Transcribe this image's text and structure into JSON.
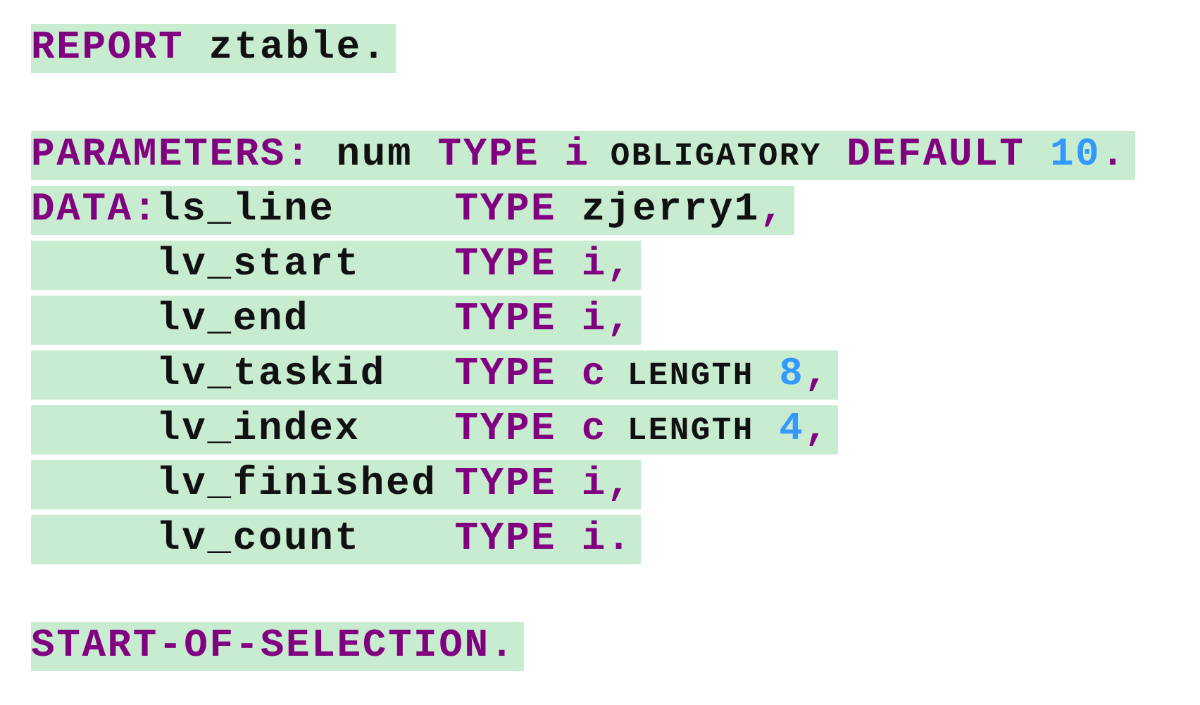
{
  "code_lines": [
    {
      "kind": "code",
      "tokens": [
        {
          "kind": "keyword",
          "text": "REPORT"
        },
        {
          "kind": "ident",
          "text": "ztable."
        }
      ]
    },
    {
      "kind": "blank"
    },
    {
      "kind": "code",
      "tokens": [
        {
          "kind": "keyword",
          "text": "PARAMETERS:"
        },
        {
          "kind": "ident",
          "text": "num"
        },
        {
          "kind": "keyword",
          "text": "TYPE"
        },
        {
          "kind": "keyword",
          "text": "i"
        },
        {
          "kind": "small",
          "text": "OBLIGATORY"
        },
        {
          "kind": "keyword",
          "text": "DEFAULT"
        },
        {
          "kind": "number",
          "text": "10"
        },
        {
          "kind": "punct",
          "text": "."
        }
      ]
    },
    {
      "kind": "decl",
      "lead": "DATA:",
      "name": "ls_line",
      "tokens": [
        {
          "kind": "keyword",
          "text": "TYPE"
        },
        {
          "kind": "ident",
          "text": "zjerry1"
        },
        {
          "kind": "punct",
          "text": ","
        }
      ]
    },
    {
      "kind": "decl",
      "name": "lv_start",
      "tokens": [
        {
          "kind": "keyword",
          "text": "TYPE"
        },
        {
          "kind": "keyword",
          "text": "i,"
        }
      ]
    },
    {
      "kind": "decl",
      "name": "lv_end",
      "tokens": [
        {
          "kind": "keyword",
          "text": "TYPE"
        },
        {
          "kind": "keyword",
          "text": "i,"
        }
      ]
    },
    {
      "kind": "decl",
      "name": "lv_taskid",
      "tokens": [
        {
          "kind": "keyword",
          "text": "TYPE"
        },
        {
          "kind": "keyword",
          "text": "c"
        },
        {
          "kind": "small",
          "text": "LENGTH"
        },
        {
          "kind": "number",
          "text": "8"
        },
        {
          "kind": "punct",
          "text": ","
        }
      ]
    },
    {
      "kind": "decl",
      "name": "lv_index",
      "tokens": [
        {
          "kind": "keyword",
          "text": "TYPE"
        },
        {
          "kind": "keyword",
          "text": "c"
        },
        {
          "kind": "small",
          "text": "LENGTH"
        },
        {
          "kind": "number",
          "text": "4"
        },
        {
          "kind": "punct",
          "text": ","
        }
      ]
    },
    {
      "kind": "decl",
      "name": "lv_finished",
      "tokens": [
        {
          "kind": "keyword",
          "text": "TYPE"
        },
        {
          "kind": "keyword",
          "text": "i,"
        }
      ]
    },
    {
      "kind": "decl",
      "name": "lv_count",
      "tokens": [
        {
          "kind": "keyword",
          "text": "TYPE"
        },
        {
          "kind": "keyword",
          "text": "i."
        }
      ]
    },
    {
      "kind": "blank"
    },
    {
      "kind": "code",
      "tokens": [
        {
          "kind": "keyword",
          "text": "START-OF-SELECTION."
        }
      ]
    }
  ]
}
